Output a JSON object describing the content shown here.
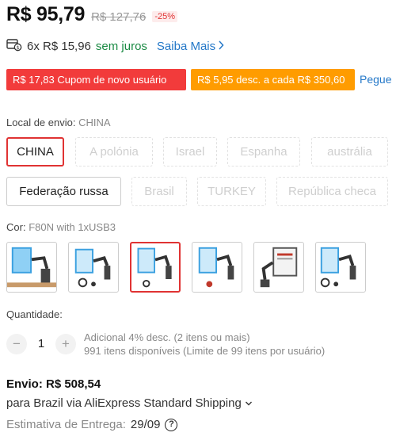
{
  "price": {
    "current": "R$ 95,79",
    "original": "R$ 127,76",
    "discount": "-25%"
  },
  "installments": {
    "text": "6x R$ 15,96",
    "interest_free": "sem juros",
    "learn_more": "Saiba Mais"
  },
  "coupons": {
    "new_user": "R$ 17,83 Cupom de novo usuário",
    "store_discount": "R$ 5,95 desc. a cada R$ 350,60",
    "link": "Pegue"
  },
  "ship_from": {
    "label": "Local de envio:",
    "value": "CHINA",
    "options": [
      {
        "label": "CHINA",
        "state": "selected"
      },
      {
        "label": "A polónia",
        "state": "disabled"
      },
      {
        "label": "Israel",
        "state": "disabled"
      },
      {
        "label": "Espanha",
        "state": "disabled"
      },
      {
        "label": "austrália",
        "state": "disabled"
      },
      {
        "label": "Federação russa",
        "state": "available"
      },
      {
        "label": "Brasil",
        "state": "disabled"
      },
      {
        "label": "TURKEY",
        "state": "disabled"
      },
      {
        "label": "República checa",
        "state": "disabled"
      }
    ]
  },
  "color": {
    "label": "Cor:",
    "value": "F80N with 1xUSB3",
    "selected_index": 2,
    "thumbnail_count": 6
  },
  "quantity": {
    "label": "Quantidade:",
    "minus": "−",
    "value": "1",
    "plus": "+",
    "extra_discount": "Adicional 4% desc. (2 itens ou mais)",
    "available": "991 itens disponíveis (Limite de 99 itens por usuário)"
  },
  "shipping": {
    "cost": "Envio: R$ 508,54",
    "via": "para Brazil via AliExpress Standard Shipping",
    "delivery_label": "Estimativa de Entrega:",
    "delivery_date": "29/09"
  },
  "colors": {
    "accent_red": "#e03333",
    "coupon_red": "#f23b3b",
    "coupon_orange": "#ff9c00",
    "link_blue": "#2478c8",
    "free_green": "#1a8a43"
  },
  "icons": {
    "installment": "installment-card-icon",
    "chevron": "chevron-right-icon",
    "dropdown": "chevron-down-icon",
    "help": "help-icon"
  }
}
